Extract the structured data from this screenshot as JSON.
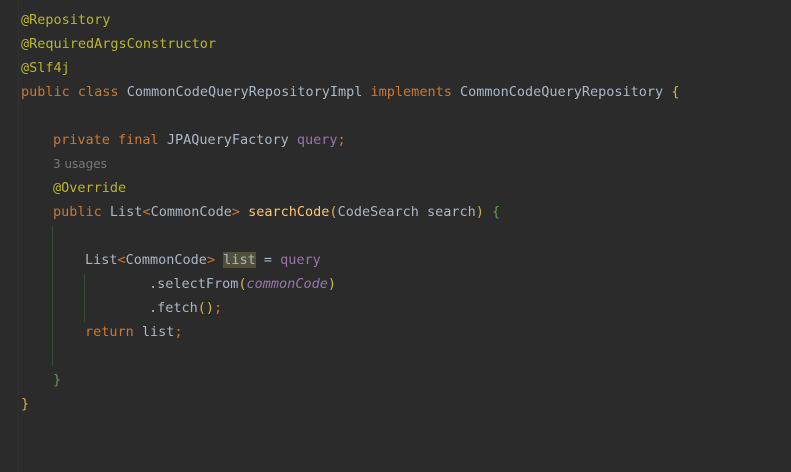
{
  "editor": {
    "annotations": [
      "@Repository",
      "@RequiredArgsConstructor",
      "@Slf4j"
    ],
    "class_decl": {
      "kw_public": "public",
      "kw_class": "class",
      "name": "CommonCodeQueryRepositoryImpl",
      "kw_implements": "implements",
      "iface": "CommonCodeQueryRepository",
      "brace": "{"
    },
    "field": {
      "kw_private": "private",
      "kw_final": "final",
      "type": "JPAQueryFactory",
      "name": "query",
      "semi": ";"
    },
    "usages_hint": "3 usages",
    "override": "@Override",
    "method": {
      "kw_public": "public",
      "ret_type": "List",
      "lt": "<",
      "generic": "CommonCode",
      "gt": ">",
      "name": "searchCode",
      "open_paren": "(",
      "param_type": "CodeSearch",
      "param_name": "search",
      "close_paren": ")",
      "brace": "{"
    },
    "body": {
      "type": "List",
      "lt": "<",
      "generic": "CommonCode",
      "gt": ">",
      "var": "list",
      "eq": "=",
      "rhs": "query",
      "select_call": ".selectFrom",
      "select_open": "(",
      "select_arg": "commonCode",
      "select_close": ")",
      "fetch_call": ".fetch",
      "fetch_parens": "()",
      "fetch_semi": ";",
      "kw_return": "return",
      "ret_var": "list",
      "ret_semi": ";"
    },
    "method_close": "}",
    "class_close": "}"
  }
}
